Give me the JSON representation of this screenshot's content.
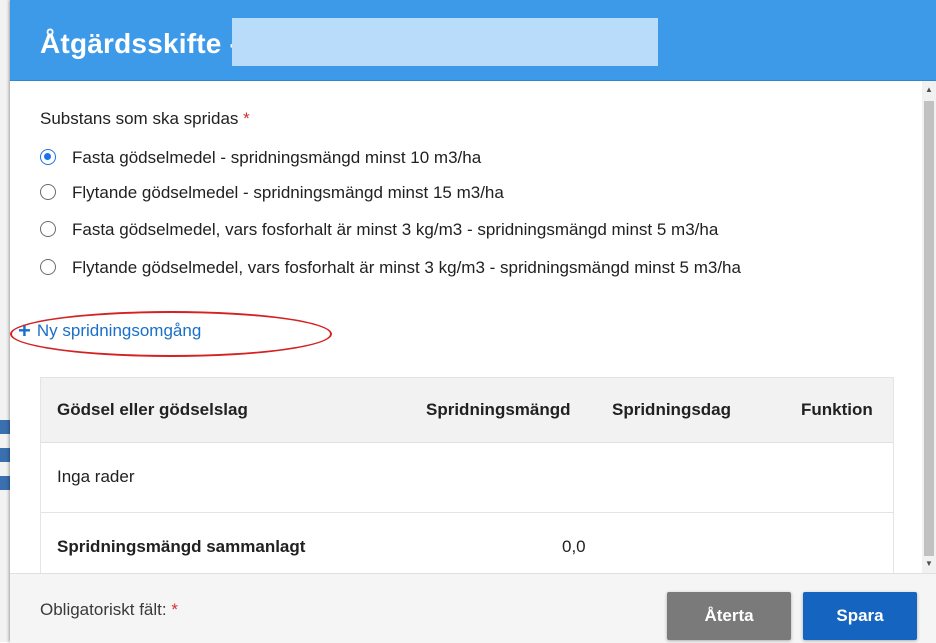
{
  "header": {
    "title": "Åtgärdsskifte -",
    "title_value": ""
  },
  "form": {
    "substance_label": "Substans som ska spridas",
    "required_marker": "*",
    "options": [
      {
        "label": "Fasta gödselmedel - spridningsmängd minst 10 m3/ha",
        "checked": true
      },
      {
        "label": "Flytande gödselmedel - spridningsmängd minst 15 m3/ha",
        "checked": false
      },
      {
        "label": "Fasta gödselmedel, vars fosforhalt är minst 3 kg/m3 - spridningsmängd minst 5 m3/ha",
        "checked": false
      },
      {
        "label": "Flytande gödselmedel, vars fosforhalt är minst 3 kg/m3 - spridningsmängd minst 5 m3/ha",
        "checked": false
      }
    ],
    "add_link": "Ny spridningsomgång"
  },
  "table": {
    "columns": [
      "Gödsel eller gödselslag",
      "Spridningsmängd",
      "Spridningsdag",
      "Funktion"
    ],
    "empty_text": "Inga rader",
    "total_label": "Spridningsmängd sammanlagt",
    "total_value": "0,0"
  },
  "footer": {
    "required_label": "Obligatoriskt fält:",
    "required_marker": "*",
    "undo_button": "Återta",
    "save_button": "Spara"
  },
  "colors": {
    "header": "#3d9ae8",
    "link": "#1a6fc9",
    "primary_button": "#1565c0",
    "secondary_button": "#7a7a7a",
    "required": "#d32f2f",
    "annotation": "#d42121"
  }
}
